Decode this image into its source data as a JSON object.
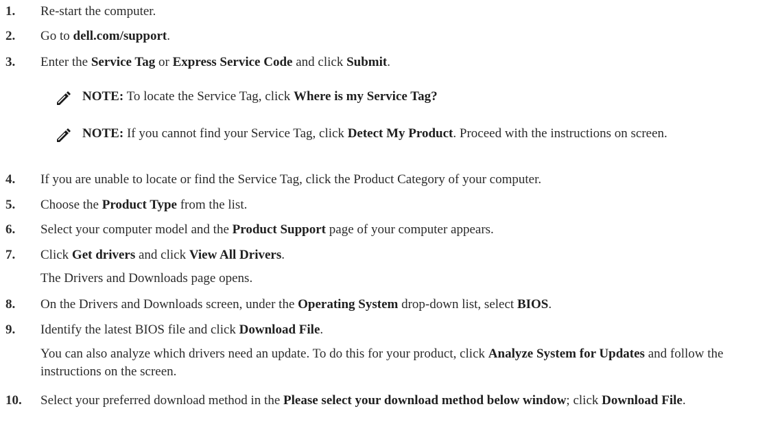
{
  "steps": [
    {
      "num": "1.",
      "parts": [
        {
          "t": "Re-start the computer."
        }
      ]
    },
    {
      "num": "2.",
      "parts": [
        {
          "t": "Go to "
        },
        {
          "b": "dell.com/support"
        },
        {
          "t": "."
        }
      ]
    },
    {
      "num": "3.",
      "parts": [
        {
          "t": "Enter the "
        },
        {
          "b": "Service Tag"
        },
        {
          "t": " or "
        },
        {
          "b": "Express Service Code"
        },
        {
          "t": " and click "
        },
        {
          "b": "Submit"
        },
        {
          "t": "."
        }
      ]
    },
    {
      "num": "4.",
      "parts": [
        {
          "t": "If you are unable to locate or find the Service Tag, click the Product Category of your computer."
        }
      ]
    },
    {
      "num": "5.",
      "parts": [
        {
          "t": "Choose the "
        },
        {
          "b": "Product Type"
        },
        {
          "t": " from the list."
        }
      ]
    },
    {
      "num": "6.",
      "parts": [
        {
          "t": "Select your computer model and the "
        },
        {
          "b": "Product Support"
        },
        {
          "t": " page of your computer appears."
        }
      ]
    },
    {
      "num": "7.",
      "parts": [
        {
          "t": "Click "
        },
        {
          "b": "Get drivers"
        },
        {
          "t": " and click "
        },
        {
          "b": "View All Drivers"
        },
        {
          "t": "."
        }
      ]
    },
    {
      "num": "8.",
      "parts": [
        {
          "t": "On the Drivers and Downloads screen, under the "
        },
        {
          "b": "Operating System"
        },
        {
          "t": " drop-down list, select "
        },
        {
          "b": "BIOS"
        },
        {
          "t": "."
        }
      ]
    },
    {
      "num": "9.",
      "parts": [
        {
          "t": "Identify the latest BIOS file and click "
        },
        {
          "b": "Download File"
        },
        {
          "t": "."
        }
      ]
    },
    {
      "num": "10.",
      "parts": [
        {
          "t": "Select your preferred download method in the "
        },
        {
          "b": "Please select your download method below window"
        },
        {
          "t": "; click "
        },
        {
          "b": "Download File"
        },
        {
          "t": "."
        }
      ]
    }
  ],
  "notes": [
    {
      "parts": [
        {
          "b": "NOTE:"
        },
        {
          "t": " To locate the Service Tag, click "
        },
        {
          "b": "Where is my Service Tag?"
        }
      ]
    },
    {
      "parts": [
        {
          "b": "NOTE:"
        },
        {
          "t": " If you cannot find your Service Tag, click "
        },
        {
          "b": "Detect My Product"
        },
        {
          "t": ". Proceed with the instructions on screen."
        }
      ]
    }
  ],
  "sub_paragraphs": [
    {
      "parts": [
        {
          "t": "The Drivers and Downloads page opens."
        }
      ]
    },
    {
      "parts": [
        {
          "t": "You can also analyze which drivers need an update. To do this for your product, click "
        },
        {
          "b": "Analyze System for Updates"
        },
        {
          "t": " and follow the instructions on the screen."
        }
      ]
    }
  ],
  "icons": {
    "note": "note-pencil-icon"
  },
  "colors": {
    "text": "#2b2b2b",
    "icon": "#1a1a1a"
  }
}
